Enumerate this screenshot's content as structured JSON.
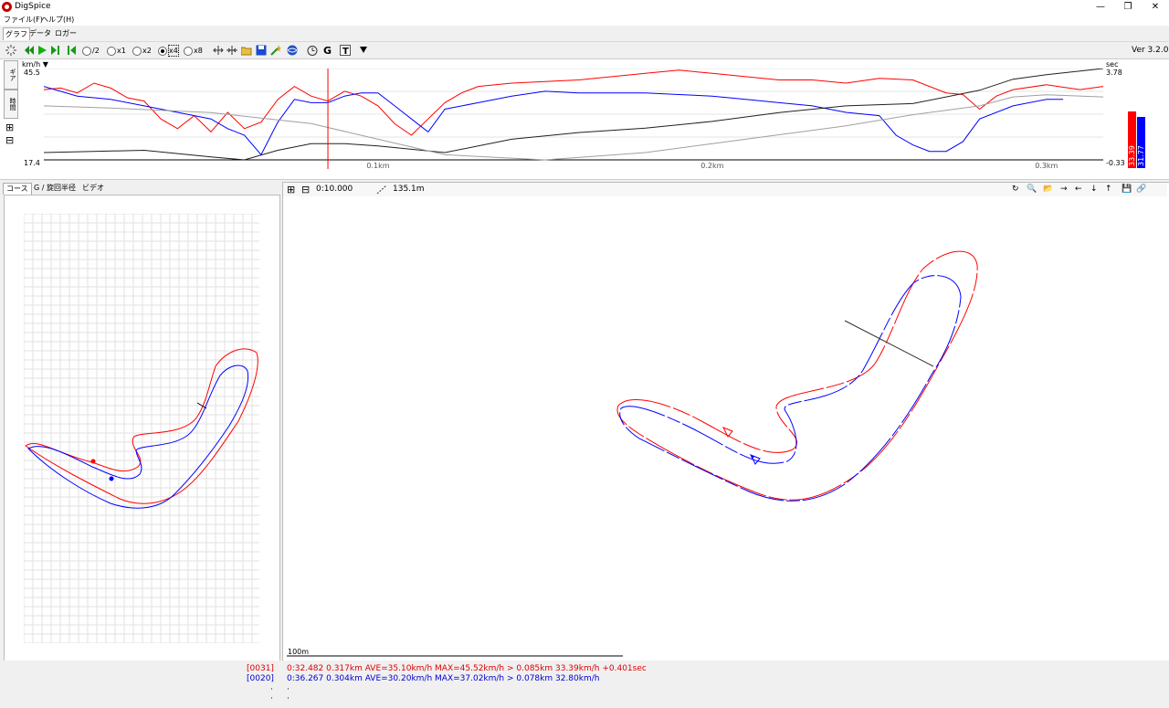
{
  "window": {
    "title": "DigSpice",
    "minimize": "—",
    "restore": "❐",
    "close": "✕"
  },
  "menu": [
    {
      "label": "ファイル(F)"
    },
    {
      "label": "ヘルプ(H)"
    }
  ],
  "tabs": [
    {
      "label": "グラフ",
      "active": true
    },
    {
      "label": "データ"
    },
    {
      "label": "ロガー"
    }
  ],
  "toolbar": {
    "speed_options": [
      "/2",
      "x1",
      "x2",
      "x4",
      "x8"
    ],
    "selected_speed": "x4",
    "version": "Ver 3.2.0"
  },
  "graph": {
    "left_unit": "km/h",
    "left_unit_arrow": "▼",
    "left_max": "45.5",
    "left_min": "17.4",
    "right_unit": "sec",
    "right_max": "3.78",
    "right_min": "-0.33",
    "vtabs": [
      "ギア",
      "時間"
    ],
    "plus": "⊞",
    "minus": "⊟",
    "bar_red_label": "33.39",
    "bar_blue_label": "31.77",
    "colors": {
      "red": "#ff0000",
      "blue": "#0000ff",
      "black": "#202020",
      "gray": "#a0a0a0"
    }
  },
  "chart_data": {
    "type": "line",
    "x_ticks": [
      "0.1km",
      "0.2km",
      "0.3km"
    ],
    "x_tick_values": [
      0.1,
      0.2,
      0.3
    ],
    "xlim": [
      0,
      0.317
    ],
    "ylim_left": [
      17.4,
      45.5
    ],
    "ylim_right": [
      -0.33,
      3.78
    ],
    "cursor_x": 0.085,
    "series": [
      {
        "color": "#ff0000",
        "axis": "left",
        "x": [
          0,
          0.005,
          0.01,
          0.015,
          0.02,
          0.025,
          0.03,
          0.035,
          0.04,
          0.045,
          0.05,
          0.055,
          0.06,
          0.065,
          0.07,
          0.075,
          0.08,
          0.085,
          0.09,
          0.095,
          0.1,
          0.105,
          0.11,
          0.115,
          0.12,
          0.125,
          0.13,
          0.14,
          0.15,
          0.16,
          0.17,
          0.18,
          0.19,
          0.2,
          0.21,
          0.22,
          0.23,
          0.24,
          0.25,
          0.26,
          0.27,
          0.275,
          0.28,
          0.285,
          0.29,
          0.3,
          0.31,
          0.317
        ],
        "y": [
          39,
          39.5,
          38,
          41,
          39.5,
          36.5,
          35.5,
          30,
          27,
          31,
          26,
          32,
          27,
          29,
          36,
          40,
          37,
          35.5,
          38.5,
          37,
          34,
          28.5,
          25,
          30,
          35,
          38,
          40,
          41,
          41.5,
          42,
          43,
          44,
          45,
          44,
          43,
          42,
          42,
          41,
          42.5,
          42,
          38,
          37.5,
          33,
          37,
          39,
          40.5,
          39,
          40
        ]
      },
      {
        "color": "#0000ff",
        "axis": "left",
        "x": [
          0,
          0.01,
          0.02,
          0.03,
          0.04,
          0.045,
          0.05,
          0.055,
          0.06,
          0.065,
          0.07,
          0.075,
          0.08,
          0.085,
          0.09,
          0.095,
          0.1,
          0.105,
          0.11,
          0.115,
          0.12,
          0.13,
          0.14,
          0.15,
          0.16,
          0.17,
          0.18,
          0.19,
          0.2,
          0.21,
          0.22,
          0.23,
          0.24,
          0.25,
          0.255,
          0.26,
          0.265,
          0.27,
          0.275,
          0.28,
          0.29,
          0.3,
          0.305
        ],
        "y": [
          40,
          37,
          36,
          34,
          32,
          31,
          30,
          27,
          25,
          19,
          29,
          36,
          35,
          35,
          37,
          38,
          38,
          34,
          30,
          26,
          33,
          35,
          37,
          38.5,
          38,
          38,
          38,
          37.5,
          37,
          36,
          35,
          34,
          32,
          31,
          25,
          22,
          20,
          20,
          23,
          30,
          34,
          36,
          36
        ]
      },
      {
        "color": "#202020",
        "axis": "right",
        "x": [
          0,
          0.03,
          0.05,
          0.06,
          0.07,
          0.08,
          0.09,
          0.1,
          0.12,
          0.14,
          0.16,
          0.18,
          0.2,
          0.22,
          0.24,
          0.26,
          0.28,
          0.29,
          0.3,
          0.317
        ],
        "y": [
          0,
          0.1,
          -0.2,
          -0.33,
          0.1,
          0.4,
          0.4,
          0.3,
          0,
          0.6,
          0.9,
          1.1,
          1.4,
          1.8,
          2.1,
          2.2,
          2.8,
          3.3,
          3.5,
          3.78
        ]
      },
      {
        "color": "#a0a0a0",
        "axis": "right",
        "x": [
          0,
          0.02,
          0.05,
          0.08,
          0.1,
          0.12,
          0.15,
          0.18,
          0.2,
          0.22,
          0.24,
          0.26,
          0.28,
          0.29,
          0.3,
          0.317
        ],
        "y": [
          2.1,
          2.0,
          1.8,
          1.3,
          0.6,
          -0.1,
          -0.33,
          0,
          0.4,
          0.8,
          1.2,
          1.7,
          2.1,
          2.5,
          2.6,
          2.5
        ]
      }
    ]
  },
  "course": {
    "tabs": [
      "コース",
      "G / 旋回半径",
      "ビデオ"
    ],
    "colors": {
      "red": "#ff0000",
      "blue": "#0000ff"
    }
  },
  "map": {
    "time": "0:10.000",
    "distance": "135.1m",
    "scale_label": "100m",
    "tools": [
      "↻",
      "🔍",
      "📂",
      "→",
      "←",
      "↓",
      "↑",
      "💾",
      "🔗"
    ]
  },
  "status": {
    "lines": [
      {
        "id": "[0031]",
        "text": "0:32.482 0.317km AVE=35.10km/h MAX=45.52km/h > 0.085km 33.39km/h +0.401sec",
        "color": "#e00000"
      },
      {
        "id": "[0020]",
        "text": "0:36.267 0.304km AVE=30.20km/h MAX=37.02km/h > 0.078km 32.80km/h",
        "color": "#0000d0"
      }
    ],
    "dots": [
      "·",
      "·"
    ]
  }
}
